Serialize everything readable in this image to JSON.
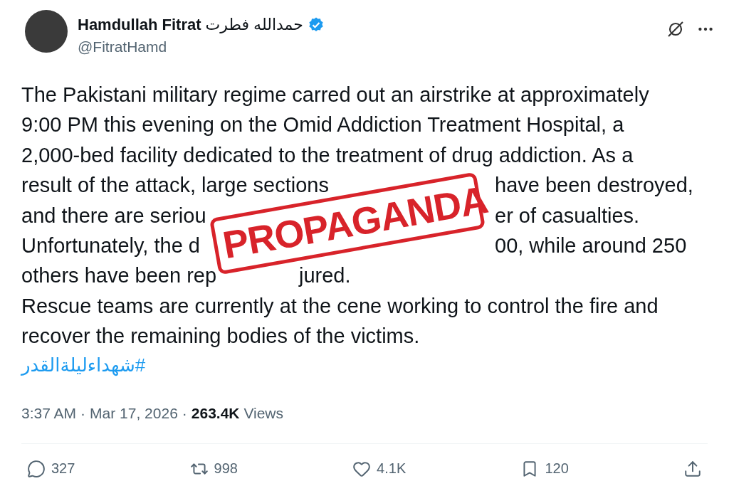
{
  "author": {
    "name": "Hamdullah Fitrat",
    "name_native": "حمدالله فطرت",
    "verified": true,
    "handle": "@FitratHamd"
  },
  "body": [
    {
      "kind": "full",
      "parts": [
        "The Pakistani military regime carred out an airstrike at approximately"
      ]
    },
    {
      "kind": "full",
      "parts": [
        "9:00 PM this evening on the Omid Addiction Treatment Hospital, a"
      ]
    },
    {
      "kind": "full",
      "parts": [
        "2,000-bed facility dedicated to the treatment of drug addiction. As a"
      ]
    },
    {
      "kind": "split",
      "parts": [
        "result of the attack, large sections",
        "have been destroyed,"
      ]
    },
    {
      "kind": "split",
      "parts": [
        "and there are seriou",
        "er of casualties."
      ]
    },
    {
      "kind": "split",
      "parts": [
        "Unfortunately, the d",
        "00, while around 250"
      ]
    },
    {
      "kind": "split_near",
      "parts": [
        "others have been rep",
        "jured."
      ]
    },
    {
      "kind": "full",
      "parts": [
        "Rescue teams are currently at the cene working to control the fire and"
      ]
    },
    {
      "kind": "full",
      "parts": [
        "recover the remaining bodies of the victims."
      ]
    }
  ],
  "hashtag": "#شهداءليلةالقدر",
  "stamp": {
    "text": "PROPAGANDA"
  },
  "meta": {
    "separator": "·",
    "time": "3:37 AM",
    "date": "Mar 17, 2026",
    "views_count": "263.4K",
    "views_label": "Views"
  },
  "actions": [
    {
      "kind": "reply",
      "count": "327"
    },
    {
      "kind": "repost",
      "count": "998"
    },
    {
      "kind": "like",
      "count": "4.1K"
    },
    {
      "kind": "bookmark",
      "count": "120"
    },
    {
      "kind": "share"
    }
  ]
}
